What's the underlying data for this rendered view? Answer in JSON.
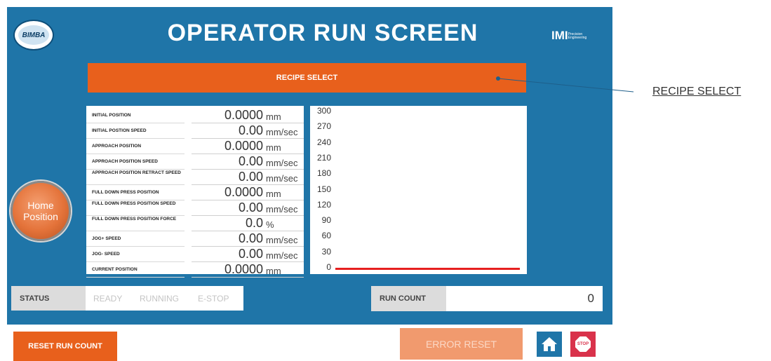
{
  "header": {
    "logo_text": "BIMBA",
    "title": "OPERATOR RUN SCREEN",
    "brand": "IMI",
    "brand_sub": "Precision Engineering"
  },
  "recipe_select_label": "RECIPE SELECT",
  "params": [
    {
      "label": "INITIAL POSITION",
      "value": "0.0000",
      "unit": "mm"
    },
    {
      "label": "INITIAL POSTION SPEED",
      "value": "0.00",
      "unit": "mm/sec"
    },
    {
      "label": "APPROACH POSITION",
      "value": "0.0000",
      "unit": "mm"
    },
    {
      "label": "APPROACH POSITION SPEED",
      "value": "0.00",
      "unit": "mm/sec"
    },
    {
      "label": "APPROACH POSITION RETRACT SPEED",
      "value": "0.00",
      "unit": "mm/sec"
    },
    {
      "label": "FULL DOWN PRESS POSITION",
      "value": "0.0000",
      "unit": "mm"
    },
    {
      "label": "FULL DOWN PRESS POSITION SPEED",
      "value": "0.00",
      "unit": "mm/sec"
    },
    {
      "label": "FULL DOWN PRESS POSITION FORCE",
      "value": "0.0",
      "unit": "%"
    },
    {
      "label": "JOG+ SPEED",
      "value": "0.00",
      "unit": "mm/sec"
    },
    {
      "label": "JOG- SPEED",
      "value": "0.00",
      "unit": "mm/sec"
    },
    {
      "label": "CURRENT POSITION",
      "value": "0.0000",
      "unit": "mm"
    }
  ],
  "chart_data": {
    "type": "line",
    "y_ticks": [
      "300",
      "270",
      "240",
      "210",
      "180",
      "150",
      "120",
      "90",
      "60",
      "30",
      "0"
    ],
    "ylim": [
      0,
      300
    ],
    "series": [
      {
        "values": [
          0,
          0
        ]
      }
    ],
    "series_color": "#e62020",
    "title": "",
    "xlabel": "",
    "ylabel": ""
  },
  "home_position_label": "Home Position",
  "status": {
    "label": "STATUS",
    "items": [
      "READY",
      "RUNNING",
      "E-STOP"
    ]
  },
  "run_count": {
    "label": "RUN COUNT",
    "value": "0"
  },
  "bottom": {
    "reset_run_count": "RESET RUN COUNT",
    "error_reset": "ERROR RESET",
    "stop_text": "STOP"
  },
  "callout": "RECIPE SELECT",
  "colors": {
    "accent": "#e8601c",
    "background": "#1f75a8",
    "line": "#e62020"
  }
}
